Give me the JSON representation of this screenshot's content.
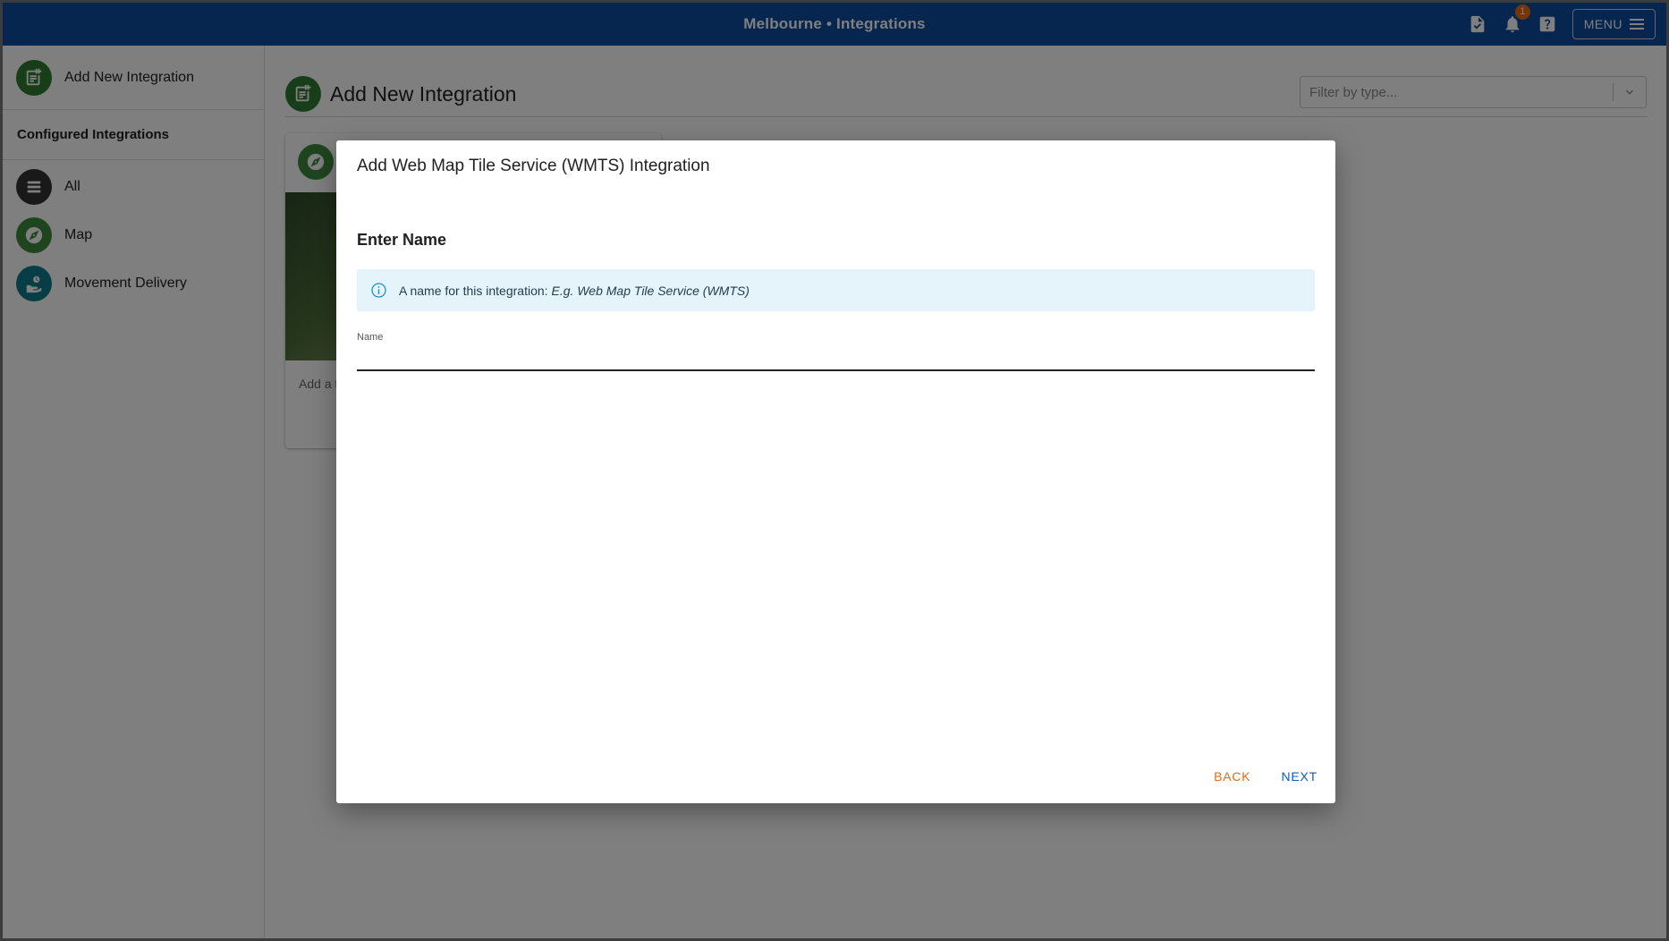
{
  "header": {
    "title": "Melbourne • Integrations",
    "notification_count": "1",
    "menu_label": "MENU",
    "icons": [
      "document-icon",
      "bell-icon",
      "help-icon",
      "hamburger-icon"
    ]
  },
  "sidebar": {
    "add_label": "Add New Integration",
    "section_heading": "Configured Integrations",
    "items": [
      {
        "label": "All",
        "icon": "list-icon",
        "color": "#333333"
      },
      {
        "label": "Map",
        "icon": "compass-icon",
        "color": "#3f8a3f"
      },
      {
        "label": "Movement Delivery",
        "icon": "delivery-icon",
        "color": "#0e7a8a"
      }
    ]
  },
  "main": {
    "title": "Add New Integration",
    "filter_placeholder": "Filter by type...",
    "card": {
      "description_prefix": "Add a t"
    }
  },
  "dialog": {
    "title": "Add Web Map Tile Service (WMTS) Integration",
    "section_title": "Enter Name",
    "info_text": "A name for this integration:",
    "info_example": "E.g. Web Map Tile Service (WMTS)",
    "field_label": "Name",
    "field_value": "",
    "back_label": "BACK",
    "next_label": "NEXT"
  },
  "colors": {
    "header_bg": "#0d4a9e",
    "accent_green": "#2e7d32",
    "back_orange": "#e86a10",
    "next_blue": "#0d5bc2",
    "info_bg": "#e5f4fb"
  }
}
